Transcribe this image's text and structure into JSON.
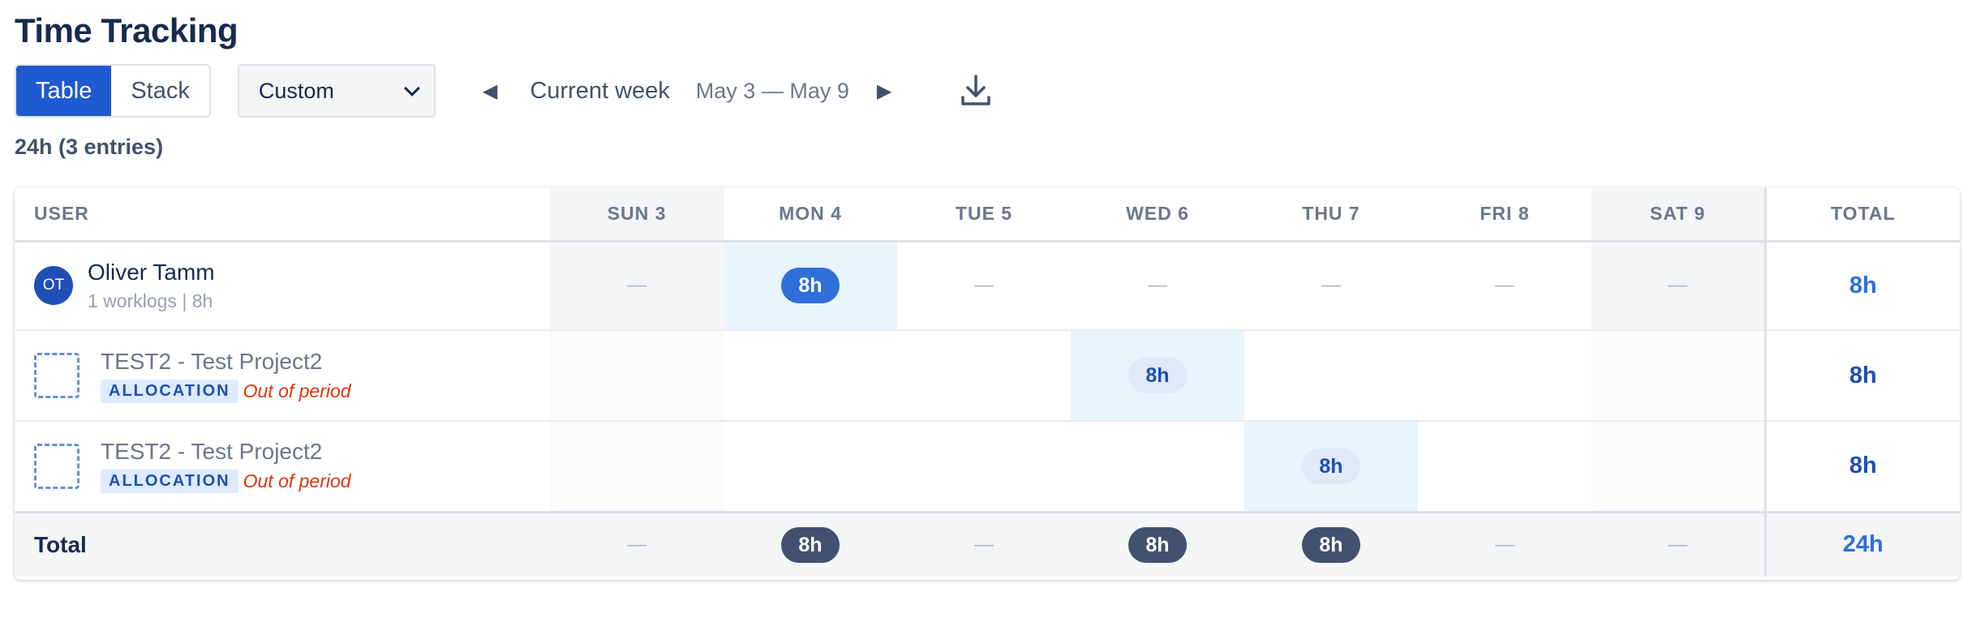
{
  "title": "Time Tracking",
  "view_toggle": {
    "table_label": "Table",
    "stack_label": "Stack",
    "active": "Table"
  },
  "period_select": {
    "value": "Custom"
  },
  "week_nav": {
    "label": "Current week",
    "range": "May 3 — May 9",
    "prev_glyph": "◀",
    "next_glyph": "▶"
  },
  "summary": "24h (3 entries)",
  "table": {
    "headers": {
      "user": "USER",
      "days": [
        "SUN 3",
        "MON 4",
        "TUE 5",
        "WED 6",
        "THU 7",
        "FRI 8",
        "SAT 9"
      ],
      "total": "TOTAL"
    },
    "user_row": {
      "avatar_initials": "OT",
      "name": "Oliver Tamm",
      "sub": "1 worklogs | 8h",
      "cells": [
        "—",
        "8h",
        "—",
        "—",
        "—",
        "—",
        "—"
      ],
      "total": "8h"
    },
    "project_rows": [
      {
        "name": "TEST2 - Test Project2",
        "tag": "ALLOCATION",
        "status": "Out of period",
        "cells": [
          "",
          "",
          "",
          "8h",
          "",
          "",
          ""
        ],
        "total": "8h"
      },
      {
        "name": "TEST2 - Test Project2",
        "tag": "ALLOCATION",
        "status": "Out of period",
        "cells": [
          "",
          "",
          "",
          "",
          "8h",
          "",
          ""
        ],
        "total": "8h"
      }
    ],
    "footer": {
      "label": "Total",
      "cells": [
        "—",
        "8h",
        "—",
        "8h",
        "8h",
        "—",
        "—"
      ],
      "total": "24h"
    }
  },
  "colors": {
    "primary": "#1f5bd0",
    "accent": "#2e6fda",
    "dark_pill": "#42526e",
    "highlight": "#e8f5fd",
    "error": "#de350b"
  }
}
